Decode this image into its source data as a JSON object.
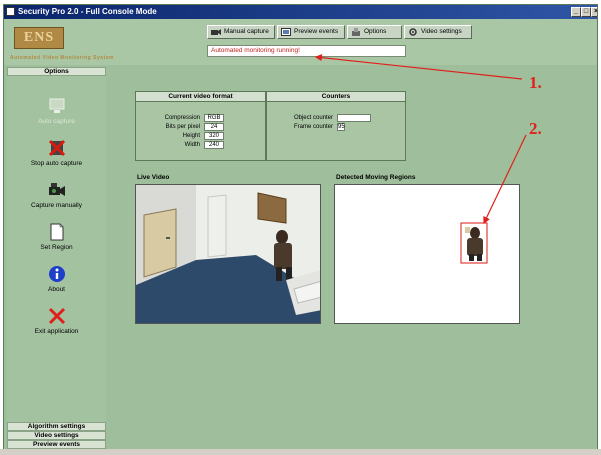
{
  "window": {
    "title": "Security Pro 2.0 - Full Console Mode",
    "controls": [
      "_",
      "□",
      "×"
    ]
  },
  "header": {
    "logo_text": "ENS",
    "tagline": "Automated Video Monitoring System",
    "toolbar": [
      {
        "label": "Manual capture",
        "icon": "camera-icon"
      },
      {
        "label": "Preview events",
        "icon": "preview-icon"
      },
      {
        "label": "Options",
        "icon": "options-icon"
      },
      {
        "label": "Video settings",
        "icon": "video-settings-icon"
      }
    ],
    "status_text": "Automated monitoring running!"
  },
  "sidebar": {
    "options_title": "Options",
    "items": [
      {
        "label": "Auto capture",
        "icon": "monitor-icon",
        "enabled": false
      },
      {
        "label": "Stop auto capture",
        "icon": "stop-icon",
        "enabled": true
      },
      {
        "label": "Capture manually",
        "icon": "camera-icon",
        "enabled": true
      },
      {
        "label": "Set Region",
        "icon": "document-icon",
        "enabled": true
      },
      {
        "label": "About",
        "icon": "info-icon",
        "enabled": true
      },
      {
        "label": "Exit application",
        "icon": "exit-icon",
        "enabled": true
      }
    ],
    "bottom_tabs": [
      "Algorithm settings",
      "Video settings",
      "Preview events"
    ]
  },
  "video_format": {
    "title": "Current video format",
    "fields": [
      {
        "label": "Compression",
        "value": "RGB"
      },
      {
        "label": "Bits per pixel",
        "value": "24"
      },
      {
        "label": "Height",
        "value": "320"
      },
      {
        "label": "Width",
        "value": "240"
      }
    ]
  },
  "counters": {
    "title": "Counters",
    "fields": [
      {
        "label": "Object counter",
        "value": ""
      },
      {
        "label": "Frame counter",
        "value": "95"
      }
    ]
  },
  "live_video": {
    "title": "Live Video"
  },
  "detected": {
    "title": "Detected Moving Regions"
  },
  "annotations": {
    "callout_1": "1.",
    "callout_2": "2.",
    "color": "#e0201c"
  }
}
